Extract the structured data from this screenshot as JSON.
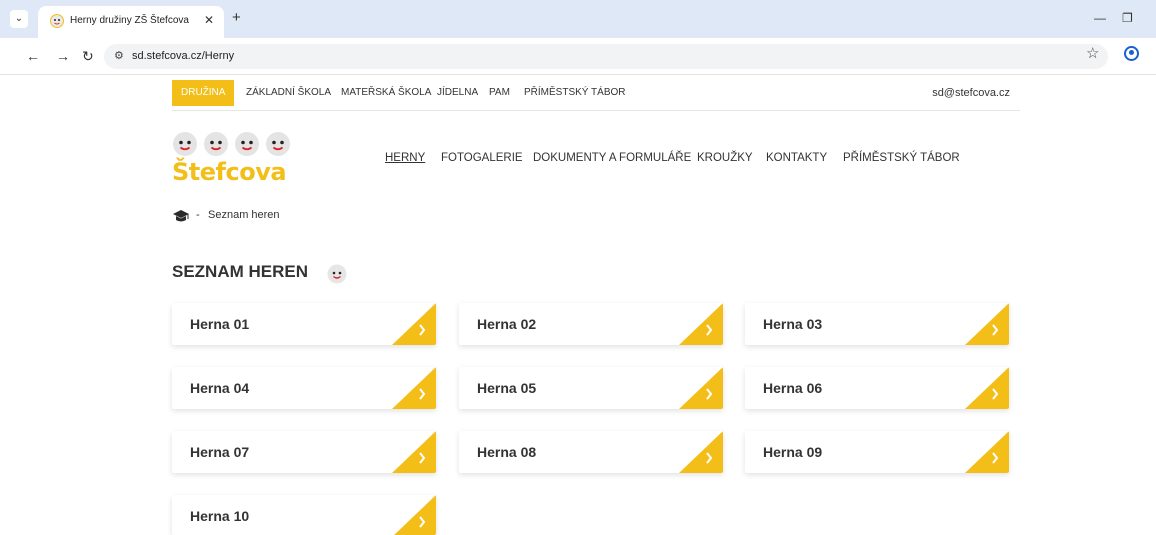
{
  "browser": {
    "tab_title": "Herny družiny ZŠ Štefcova",
    "url": "sd.stefcova.cz/Herny"
  },
  "colors": {
    "accent": "#f2be17",
    "text": "#333333"
  },
  "topbar": {
    "links": [
      {
        "label": "DRUŽINA"
      },
      {
        "label": "ZÁKLADNÍ ŠKOLA"
      },
      {
        "label": "MATEŘSKÁ ŠKOLA"
      },
      {
        "label": "JÍDELNA"
      },
      {
        "label": "PAM"
      },
      {
        "label": "PŘÍMĚSTSKÝ TÁBOR"
      }
    ],
    "email": "sd@stefcova.cz"
  },
  "logo": {
    "text": "Štefcova"
  },
  "mainnav": {
    "items": [
      {
        "label": "HERNY"
      },
      {
        "label": "FOTOGALERIE"
      },
      {
        "label": "DOKUMENTY A FORMULÁŘE"
      },
      {
        "label": "KROUŽKY"
      },
      {
        "label": "KONTAKTY"
      },
      {
        "label": "PŘÍMĚSTSKÝ TÁBOR"
      }
    ]
  },
  "breadcrumb": {
    "separator": "-",
    "current": "Seznam heren"
  },
  "section": {
    "title": "SEZNAM HEREN",
    "cards": [
      {
        "label": "Herna 01"
      },
      {
        "label": "Herna 02"
      },
      {
        "label": "Herna 03"
      },
      {
        "label": "Herna 04"
      },
      {
        "label": "Herna 05"
      },
      {
        "label": "Herna 06"
      },
      {
        "label": "Herna 07"
      },
      {
        "label": "Herna 08"
      },
      {
        "label": "Herna 09"
      },
      {
        "label": "Herna 10"
      }
    ]
  }
}
